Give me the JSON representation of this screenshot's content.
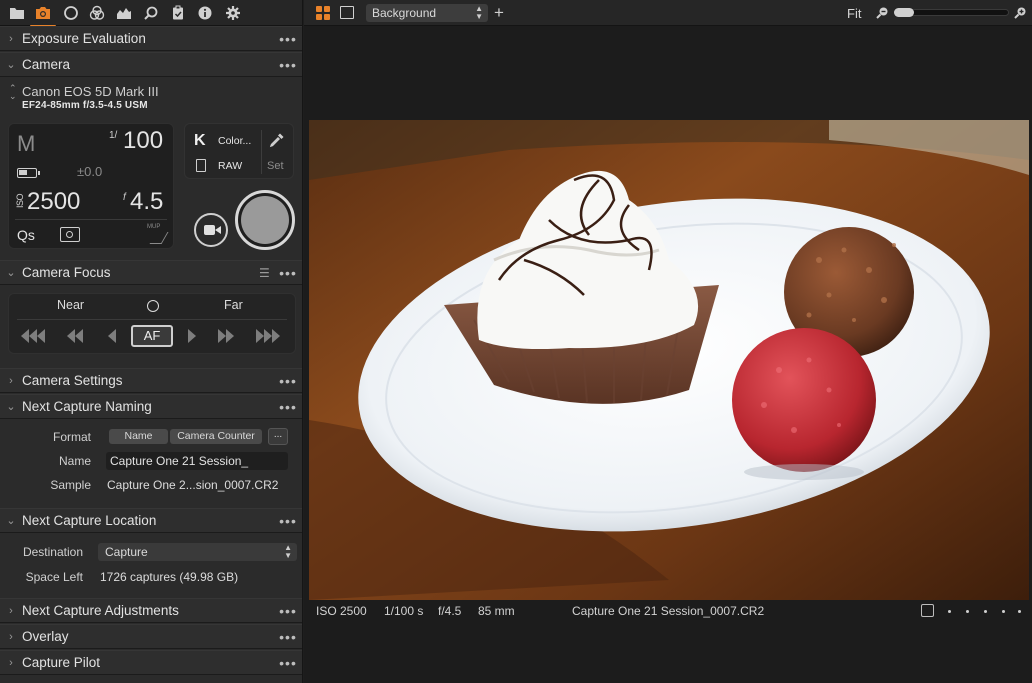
{
  "tool_tabs": [
    {
      "icon": "folder-icon"
    },
    {
      "icon": "camera-icon",
      "active": true
    },
    {
      "icon": "lens-icon"
    },
    {
      "icon": "color-icon"
    },
    {
      "icon": "exposure-icon"
    },
    {
      "icon": "search-icon"
    },
    {
      "icon": "clipboard-icon"
    },
    {
      "icon": "info-icon"
    },
    {
      "icon": "gear-icon"
    }
  ],
  "sections": {
    "exposure_evaluation": "Exposure Evaluation",
    "camera": "Camera",
    "camera_focus": "Camera Focus",
    "camera_settings": "Camera Settings",
    "next_capture_naming": "Next Capture Naming",
    "next_capture_location": "Next Capture Location",
    "next_capture_adjustments": "Next Capture Adjustments",
    "overlay": "Overlay",
    "capture_pilot": "Capture Pilot"
  },
  "camera": {
    "model": "Canon EOS 5D Mark III",
    "lens": "EF24-85mm f/3.5-4.5 USM",
    "mode": "M",
    "shutter_prefix": "1/",
    "shutter": "100",
    "ev": "±0.0",
    "iso_label": "ISO",
    "iso": "2500",
    "aperture_prefix": "f",
    "aperture": "4.5",
    "quick": "Qs",
    "mup": "MUP",
    "format_k": "K",
    "format_color": "Color...",
    "format_raw": "RAW",
    "set_label": "Set"
  },
  "focus": {
    "near": "Near",
    "far": "Far",
    "af": "AF"
  },
  "naming": {
    "format_label": "Format",
    "tokens": [
      "Name",
      "Camera Counter"
    ],
    "more": "...",
    "name_label": "Name",
    "name_value": "Capture One 21 Session_",
    "sample_label": "Sample",
    "sample_value": "Capture One 2...sion_0007.CR2"
  },
  "location": {
    "destination_label": "Destination",
    "destination_value": "Capture",
    "space_label": "Space Left",
    "space_value": "1726 captures (49.98 GB)"
  },
  "viewer": {
    "background_select": "Background",
    "fit": "Fit",
    "status": {
      "iso": "ISO 2500",
      "shutter": "1/100 s",
      "aperture": "f/4.5",
      "focal": "85 mm",
      "filename": "Capture One 21 Session_0007.CR2"
    }
  },
  "colors": {
    "accent": "#e8822a",
    "panel": "#2b2b2b",
    "viewer_bg": "#1c1c1c"
  }
}
